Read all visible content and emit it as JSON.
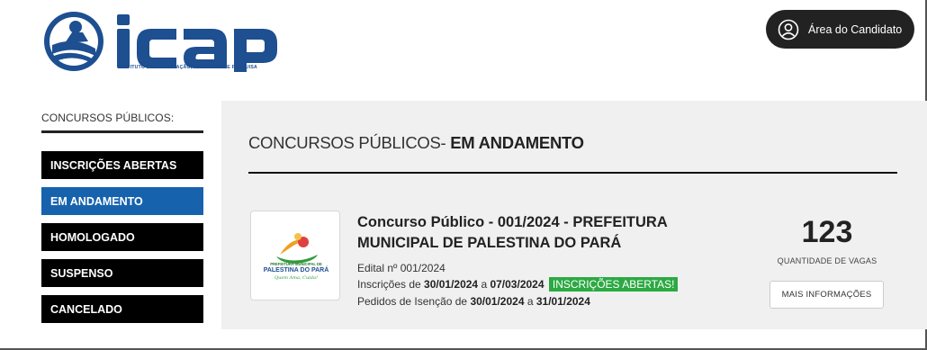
{
  "header": {
    "logo_text": "icap",
    "logo_subtitle": "INSTITUTO DE CAPACITAÇÃO, ASSESSORIA E PESQUISA",
    "candidate_area_label": "Área do Candidato"
  },
  "sidebar": {
    "title": "CONCURSOS PÚBLICOS:",
    "items": [
      {
        "label": "INSCRIÇÕES ABERTAS",
        "active": false
      },
      {
        "label": "EM ANDAMENTO",
        "active": true
      },
      {
        "label": "HOMOLOGADO",
        "active": false
      },
      {
        "label": "SUSPENSO",
        "active": false
      },
      {
        "label": "CANCELADO",
        "active": false
      }
    ]
  },
  "main": {
    "title_prefix": "CONCURSOS PÚBLICOS- ",
    "title_strong": "EM ANDAMENTO",
    "contest": {
      "title": "Concurso Público - 001/2024 - PREFEITURA MUNICIPAL DE PALESTINA DO PARÁ",
      "org_logo_text_1": "PREFEITURA MUNICIPAL DE",
      "org_logo_text_2": "PALESTINA DO PARÁ",
      "org_logo_slogan": "Quem Ama, Cuida!",
      "edital": "Edital nº 001/2024",
      "inscricoes_prefix": "Inscrições de ",
      "inscricoes_start": "30/01/2024",
      "inscricoes_mid": " a ",
      "inscricoes_end": "07/03/2024",
      "status_badge": "INSCRIÇÕES ABERTAS!",
      "isencao_prefix": "Pedidos de Isenção de ",
      "isencao_start": "30/01/2024",
      "isencao_mid": " a ",
      "isencao_end": "31/01/2024",
      "vagas_count": "123",
      "vagas_label": "QUANTIDADE DE VAGAS",
      "more_info_label": "MAIS INFORMAÇÕES"
    }
  },
  "colors": {
    "brand_blue": "#1d4f91",
    "active_blue": "#1762ad",
    "badge_green": "#2ca943",
    "dark": "#222222"
  }
}
